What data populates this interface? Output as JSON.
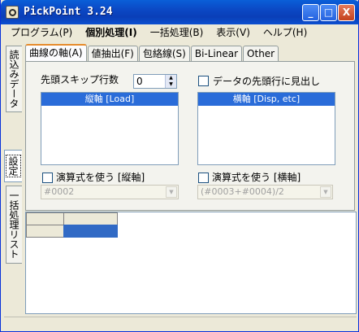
{
  "window": {
    "title": "PickPoint 3.24",
    "minimize_label": "_",
    "maximize_label": "□",
    "close_label": "X"
  },
  "menu": [
    {
      "label": "プログラム(P)",
      "bold": false
    },
    {
      "label": "個別処理(I)",
      "bold": true
    },
    {
      "label": "一括処理(B)",
      "bold": false
    },
    {
      "label": "表示(V)",
      "bold": false
    },
    {
      "label": "ヘルプ(H)",
      "bold": false
    }
  ],
  "side_tabs": {
    "read_data": "読込みデータ",
    "settings": "設定",
    "batch_list": "一括処理リスト"
  },
  "tabs": {
    "curve_axis": "曲線の軸(A)",
    "value_extract": "値抽出(F)",
    "envelope": "包絡線(S)",
    "bilinear": "Bi-Linear",
    "other": "Other"
  },
  "settings": {
    "skip_rows_label": "先頭スキップ行数",
    "skip_rows_value": "0",
    "header_checkbox_label": "データの先頭行に見出し",
    "y_axis_header": "縦軸 [Load]",
    "x_axis_header": "横軸 [Disp, etc]",
    "y_expr_checkbox_label": "演算式を使う [縦軸]",
    "x_expr_checkbox_label": "演算式を使う [横軸]",
    "y_expr_value": "#0002",
    "x_expr_value": "(#0003+#0004)/2"
  },
  "colors": {
    "titlebar": "#0b48c4",
    "list_header": "#2a6cd9",
    "selected_cell": "#316ac5",
    "active_tab_accent": "#e68b2c"
  }
}
